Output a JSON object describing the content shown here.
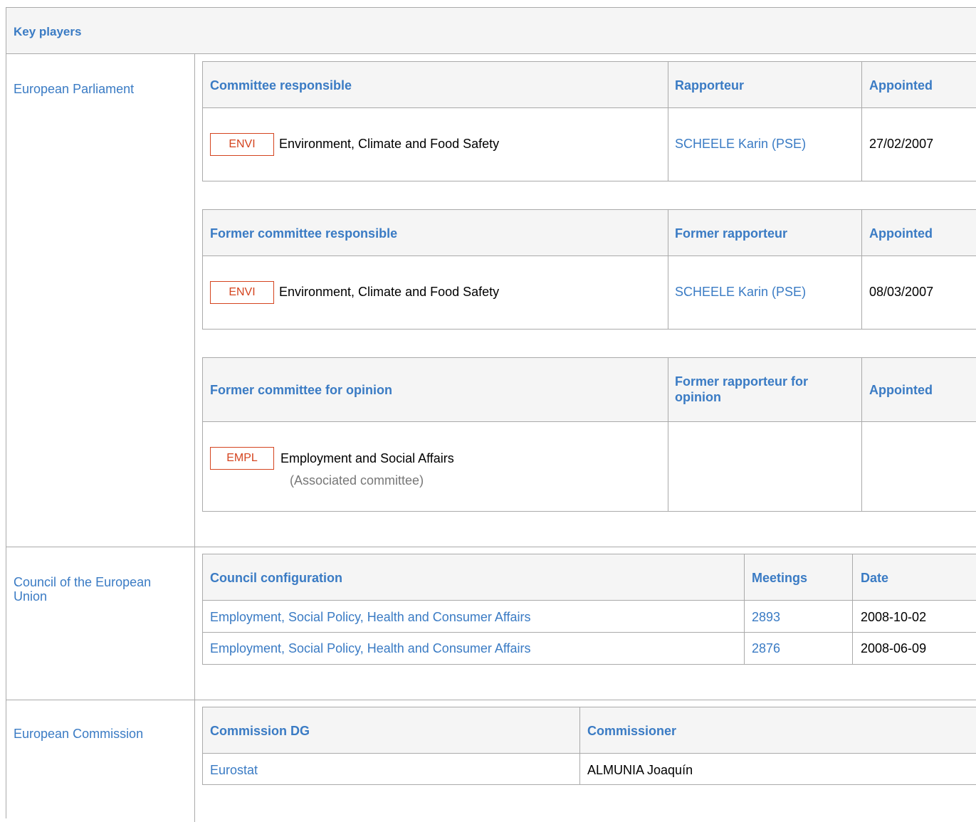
{
  "title": "Key players",
  "sections": {
    "parliament": {
      "label": "European Parliament",
      "tables": [
        {
          "headers": [
            "Committee responsible",
            "Rapporteur",
            "Appointed"
          ],
          "badge": "ENVI",
          "committee": "Environment, Climate and Food Safety",
          "rapporteur": "SCHEELE Karin (PSE)",
          "appointed": "27/02/2007"
        },
        {
          "headers": [
            "Former committee responsible",
            "Former rapporteur",
            "Appointed"
          ],
          "badge": "ENVI",
          "committee": "Environment, Climate and Food Safety",
          "rapporteur": "SCHEELE Karin (PSE)",
          "appointed": "08/03/2007"
        },
        {
          "headers": [
            "Former committee for opinion",
            "Former rapporteur for opinion",
            "Appointed"
          ],
          "badge": "EMPL",
          "committee": "Employment and Social Affairs",
          "note": "(Associated committee)"
        }
      ]
    },
    "council": {
      "label": "Council of the European Union",
      "headers": [
        "Council configuration",
        "Meetings",
        "Date"
      ],
      "rows": [
        {
          "configuration": "Employment, Social Policy, Health and Consumer Affairs",
          "meeting": "2893",
          "date": "2008-10-02"
        },
        {
          "configuration": "Employment, Social Policy, Health and Consumer Affairs",
          "meeting": "2876",
          "date": "2008-06-09"
        }
      ]
    },
    "commission": {
      "label": "European Commission",
      "headers": [
        "Commission DG",
        "Commissioner"
      ],
      "rows": [
        {
          "dg": "Eurostat",
          "commissioner": "ALMUNIA Joaquín"
        }
      ]
    }
  },
  "colors": {
    "link": "#3a7bc4",
    "badge": "#d4441f",
    "border": "#aaaaaa",
    "header_bg": "#f5f5f5"
  }
}
